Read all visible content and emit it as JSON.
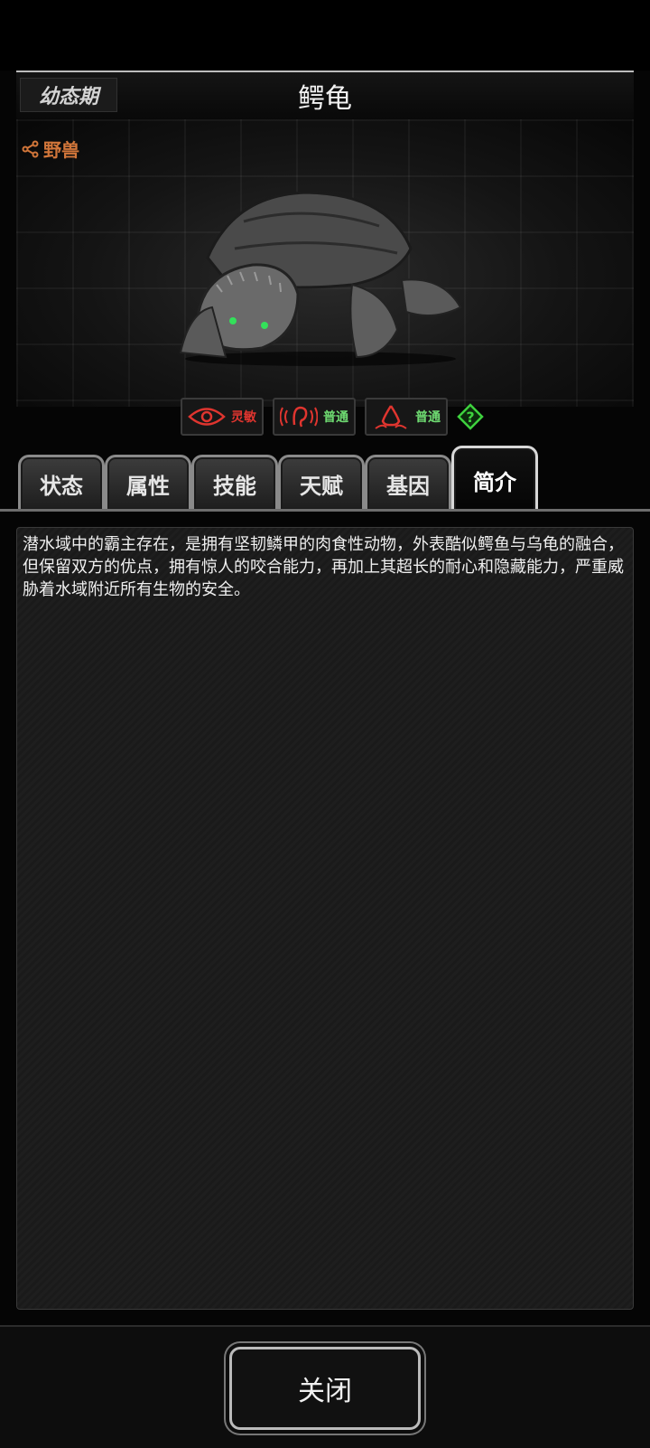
{
  "header": {
    "stage": "幼态期",
    "title": "鳄龟"
  },
  "category": {
    "label": "野兽",
    "icon": "share-icon",
    "color": "#d2763a"
  },
  "senses": [
    {
      "icon": "eye-icon",
      "label": "灵敏",
      "color": "#e0352f"
    },
    {
      "icon": "ear-icon",
      "label": "普通",
      "color": "#6fdc72"
    },
    {
      "icon": "nose-icon",
      "label": "普通",
      "color": "#6fdc72"
    }
  ],
  "help": {
    "icon": "question-diamond-icon",
    "color": "#3ed23e"
  },
  "tabs": [
    {
      "label": "状态"
    },
    {
      "label": "属性"
    },
    {
      "label": "技能"
    },
    {
      "label": "天赋"
    },
    {
      "label": "基因"
    },
    {
      "label": "简介",
      "active": true
    }
  ],
  "description": "潜水域中的霸主存在，是拥有坚韧鳞甲的肉食性动物，外表酷似鳄鱼与乌龟的融合，但保留双方的优点，拥有惊人的咬合能力，再加上其超长的耐心和隐藏能力，严重威胁着水域附近所有生物的安全。",
  "footer": {
    "close_label": "关闭"
  }
}
